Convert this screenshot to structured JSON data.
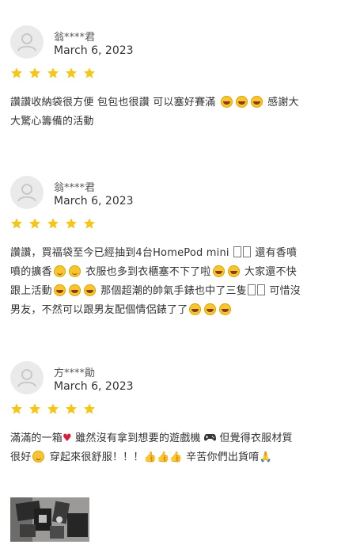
{
  "reviews": [
    {
      "user": "翁****君",
      "date": "March 6, 2023",
      "rating": 5,
      "text_parts": [
        "讚讚收納袋很方便 包包也很讚 可以塞好賽滿",
        "大驚心籌備的活動",
        "感謝大"
      ]
    },
    {
      "user": "翁****君",
      "date": "March 6, 2023",
      "rating": 5,
      "text_parts": [
        "讚讚，買福袋至今已經抽到4台HomePod mini",
        "還有香噴",
        "噴的擴香",
        "衣服也多到衣櫃塞不下了啦",
        "大家還不快",
        "跟上活動",
        "那個超潮的帥氣手錶也中了三隻",
        "可惜沒",
        "男友，不然可以跟男友配個情侶錶了了"
      ]
    },
    {
      "user": "方****勛",
      "date": "March 6, 2023",
      "rating": 5,
      "text_parts": [
        "滿滿的一箱",
        "雖然沒有拿到想要的遊戲機",
        "但覺得衣服材質",
        "很好",
        "穿起來很舒服！！！",
        "辛苦你們出貨唷"
      ]
    }
  ],
  "colors": {
    "star": "#f5c518",
    "avatar_bg": "#eaeaea",
    "text": "#333333"
  },
  "icons": [
    "user-avatar-icon",
    "star-icon",
    "laughing-emoji-icon",
    "smile-emoji-icon",
    "heart-icon",
    "gamepad-icon",
    "thumbs-up-icon",
    "pray-icon"
  ]
}
